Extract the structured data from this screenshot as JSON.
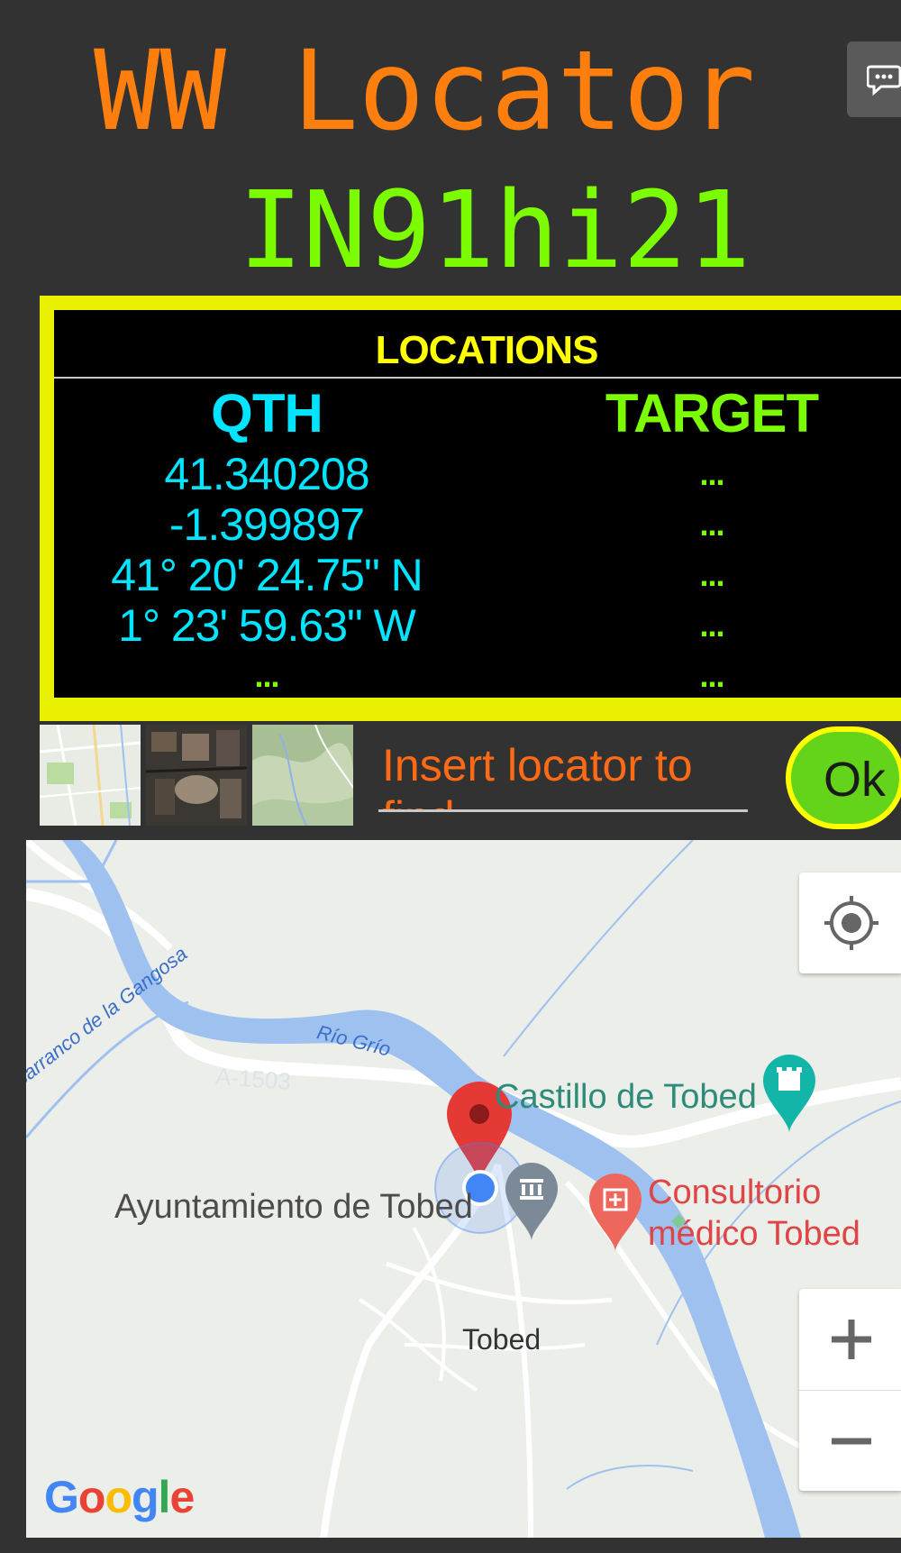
{
  "app": {
    "title": "WW Locator",
    "locator": "IN91hi21"
  },
  "locations": {
    "header": "LOCATIONS",
    "qth": {
      "heading": "QTH",
      "latitude": "41.340208",
      "longitude": "-1.399897",
      "lat_dms": "41° 20' 24.75\" N",
      "lon_dms": "1° 23' 59.63\" W",
      "extra": "..."
    },
    "target": {
      "heading": "TARGET",
      "rows": [
        "...",
        "...",
        "...",
        "...",
        "..."
      ]
    }
  },
  "input": {
    "placeholder": "Insert locator to find"
  },
  "ok_button": "Ok",
  "map": {
    "labels": {
      "town_hall": "Ayuntamiento de Tobed",
      "castle": "Castillo de Tobed",
      "clinic_line1": "Consultorio",
      "clinic_line2": "médico Tobed",
      "town": "Tobed",
      "river": "Río Grío",
      "ravine": "Barranco de la Gangosa",
      "road": "A-1503"
    },
    "google_logo": {
      "G": "G",
      "o1": "o",
      "o2": "o",
      "g": "g",
      "l": "l",
      "e": "e"
    }
  },
  "colors": {
    "background": "#323232",
    "title": "#ff7f0e",
    "locator": "#7cfc00",
    "panel_border": "#e9f000",
    "qth_text": "#00e5ff",
    "target_text": "#7cfc00",
    "placeholder": "#ff6a14",
    "ok_fill": "#64d41a",
    "pin": "#e53935",
    "my_location": "#4285f4"
  },
  "icons": {
    "chat": "chat-bubble-icon",
    "locate": "my-location-icon",
    "zoom_in": "plus-icon",
    "zoom_out": "minus-icon",
    "pin": "map-pin-icon",
    "museum": "museum-icon",
    "castle": "castle-icon",
    "clinic": "clinic-icon"
  }
}
